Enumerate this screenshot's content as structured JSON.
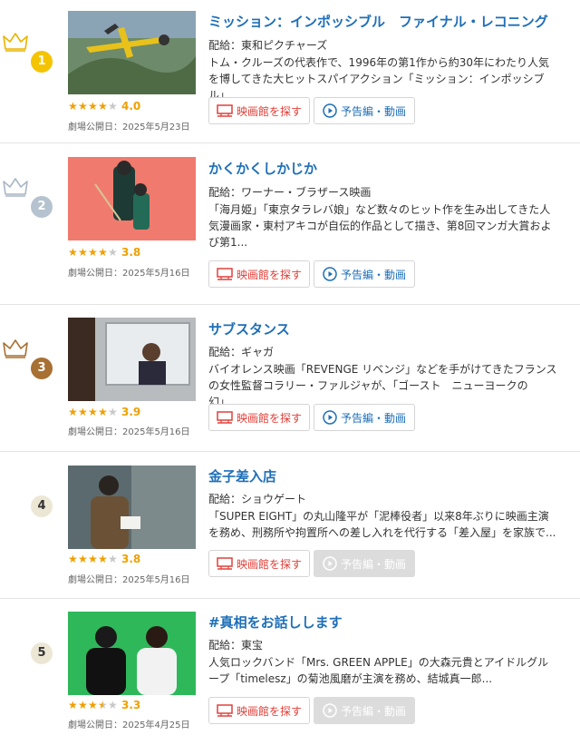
{
  "labels": {
    "theater_button": "映画館を探す",
    "trailer_button": "予告編・動画",
    "release_prefix": "劇場公開日："
  },
  "colors": {
    "title": "#1e6fb8",
    "theater_button": "#e0403a",
    "star": "#f0a000",
    "rank_1": "#f5c400",
    "rank_2": "#b5c2cf",
    "rank_3": "#a87033",
    "rank_other": "#ece7d5"
  },
  "movies": [
    {
      "rank": "1",
      "title": "ミッション：インポッシブル　ファイナル・レコニング",
      "distributor": "配給：東和ピクチャーズ",
      "description": "トム・クルーズの代表作で、1996年の第1作から約30年にわたり人気を博してきた大ヒットスパイアクション「ミッション：インポッシブル」...",
      "stars": 4.0,
      "score": "4.0",
      "release": "劇場公開日：2025年5月23日",
      "trailer_available": true
    },
    {
      "rank": "2",
      "title": "かくかくしかじか",
      "distributor": "配給：ワーナー・ブラザース映画",
      "description": "「海月姫」「東京タラレバ娘」など数々のヒット作を生み出してきた人気漫画家・東村アキコが自伝的作品として描き、第8回マンガ大賞および第1...",
      "stars": 3.8,
      "score": "3.8",
      "release": "劇場公開日：2025年5月16日",
      "trailer_available": true
    },
    {
      "rank": "3",
      "title": "サブスタンス",
      "distributor": "配給：ギャガ",
      "description": "バイオレンス映画「REVENGE リベンジ」などを手がけてきたフランスの女性監督コラリー・ファルジャが、「ゴースト　ニューヨークの幻」...",
      "stars": 3.9,
      "score": "3.9",
      "release": "劇場公開日：2025年5月16日",
      "trailer_available": true
    },
    {
      "rank": "4",
      "title": "金子差入店",
      "distributor": "配給：ショウゲート",
      "description": "「SUPER EIGHT」の丸山隆平が「泥棒役者」以来8年ぶりに映画主演を務め、刑務所や拘置所への差し入れを代行する「差入屋」を家族で...",
      "stars": 3.8,
      "score": "3.8",
      "release": "劇場公開日：2025年5月16日",
      "trailer_available": false
    },
    {
      "rank": "5",
      "title": "#真相をお話しします",
      "distributor": "配給：東宝",
      "description": "人気ロックバンド「Mrs. GREEN APPLE」の大森元貴とアイドルグループ「timelesz」の菊池風磨が主演を務め、結城真一郎...",
      "stars": 3.3,
      "score": "3.3",
      "release": "劇場公開日：2025年4月25日",
      "trailer_available": false
    }
  ]
}
